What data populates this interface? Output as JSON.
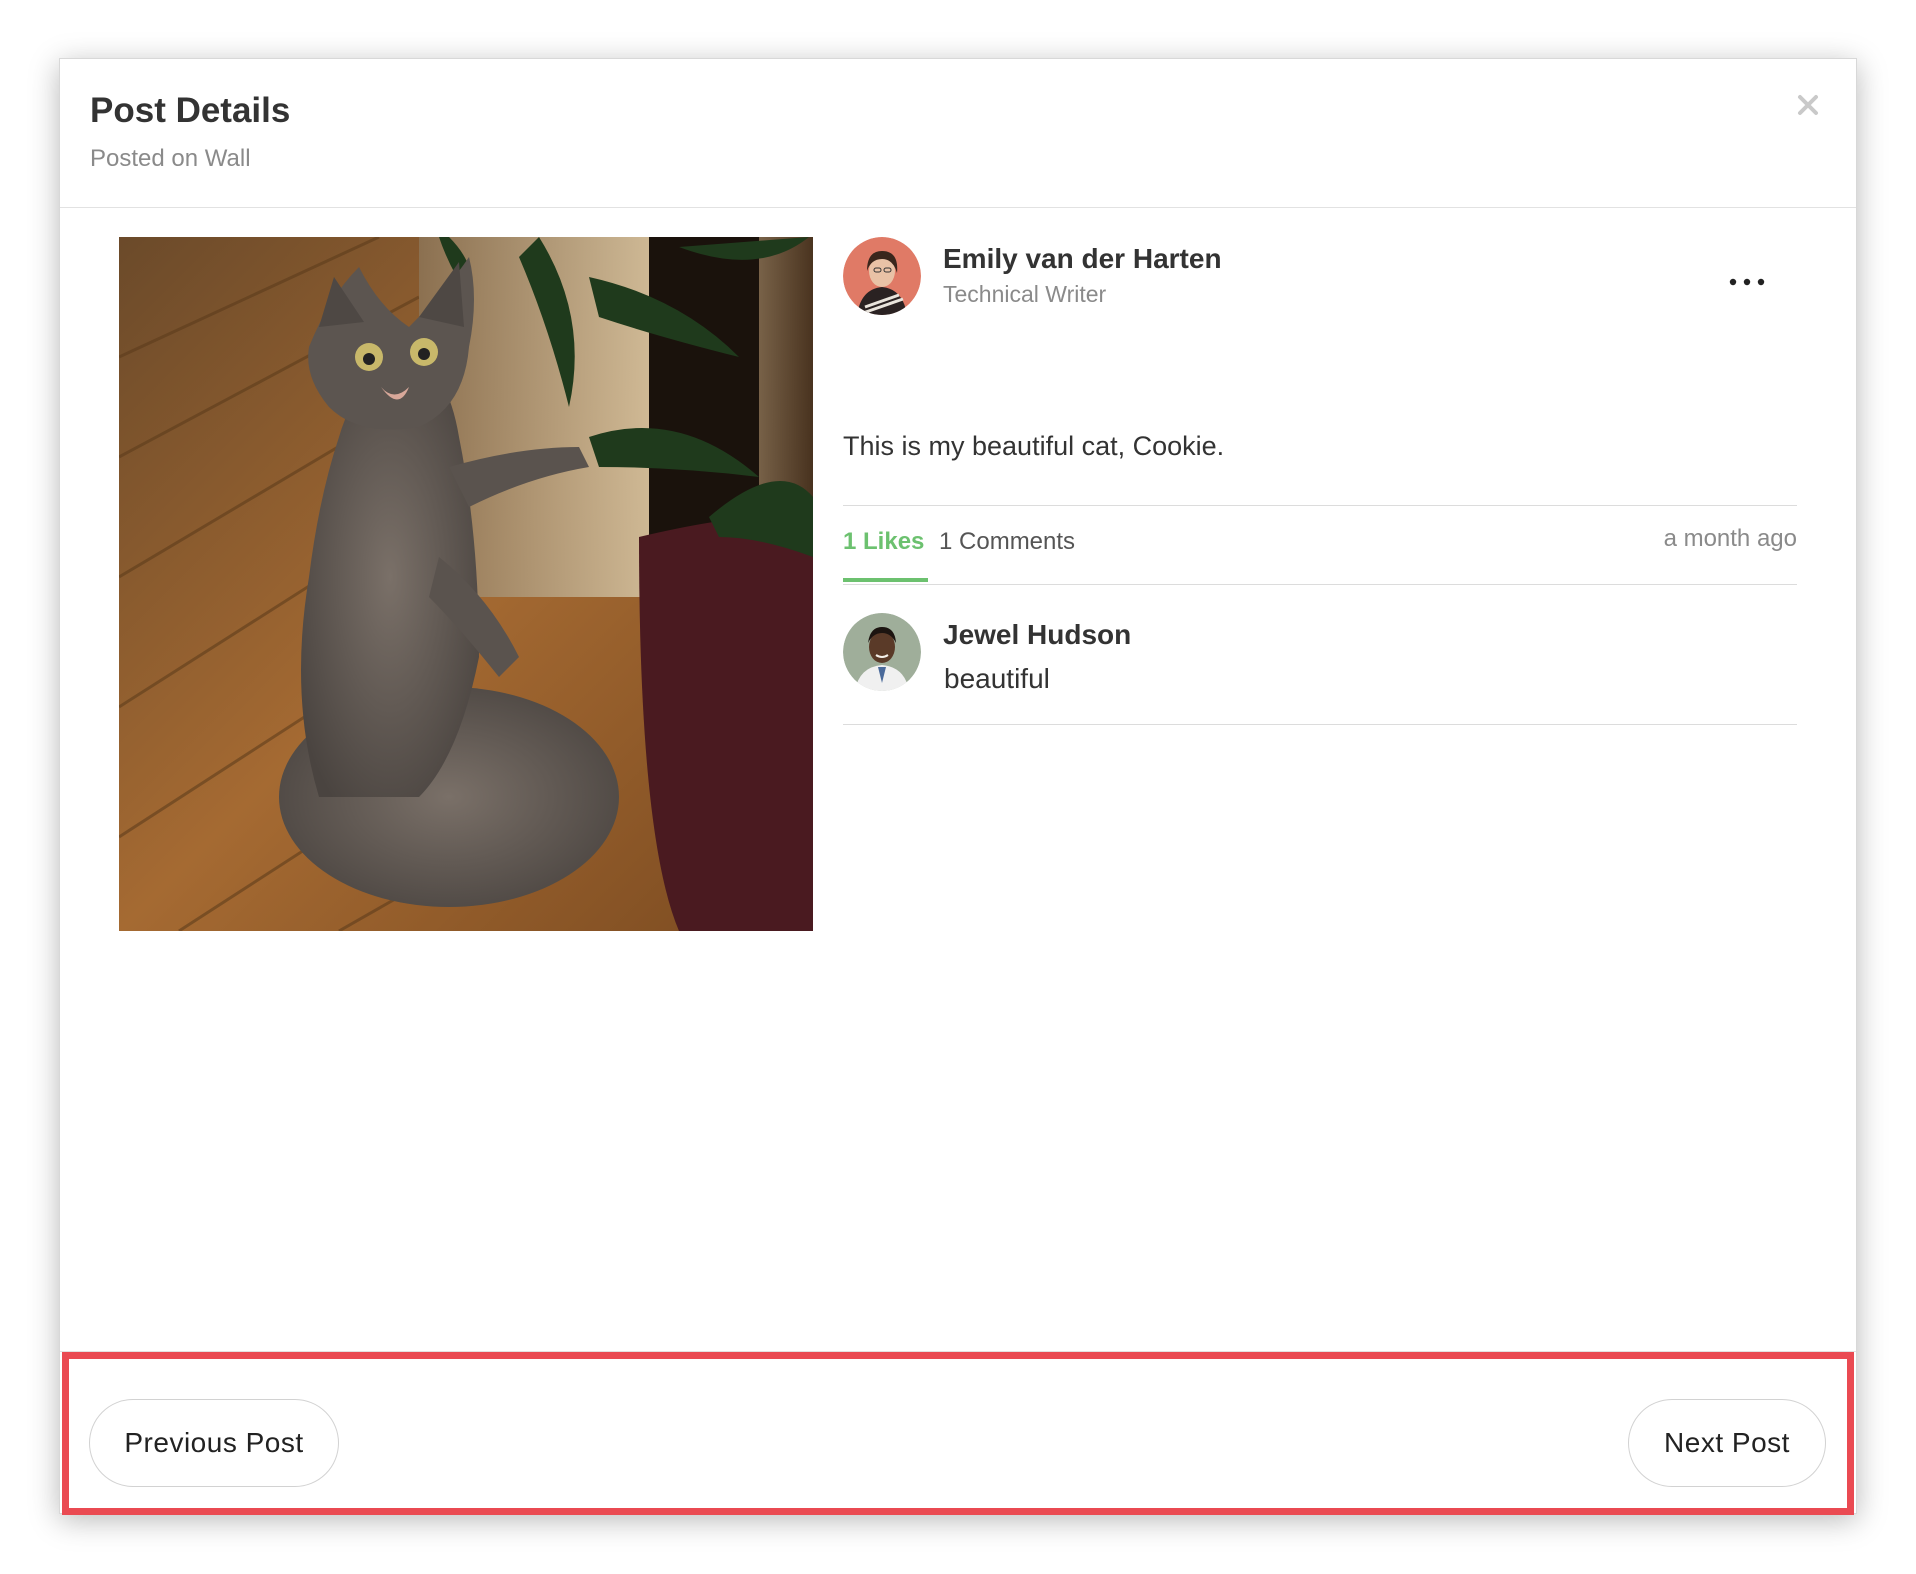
{
  "modal": {
    "title": "Post Details",
    "subtitle": "Posted on Wall",
    "close_icon": "close-icon"
  },
  "post": {
    "author": {
      "name": "Emily van der Harten",
      "role": "Technical Writer",
      "avatar_icon": "user-avatar"
    },
    "more_icon": "more-horizontal-icon",
    "text": "This is my beautiful cat, Cookie.",
    "likes_label": "1 Likes",
    "comments_label": "1 Comments",
    "time": "a month ago"
  },
  "comments": [
    {
      "author": "Jewel Hudson",
      "text": "beautiful"
    }
  ],
  "footer": {
    "previous_label": "Previous Post",
    "next_label": "Next Post"
  },
  "colors": {
    "accent_green": "#6cc16f",
    "highlight_red": "#ea4a52",
    "muted_text": "#8a8a8a"
  }
}
